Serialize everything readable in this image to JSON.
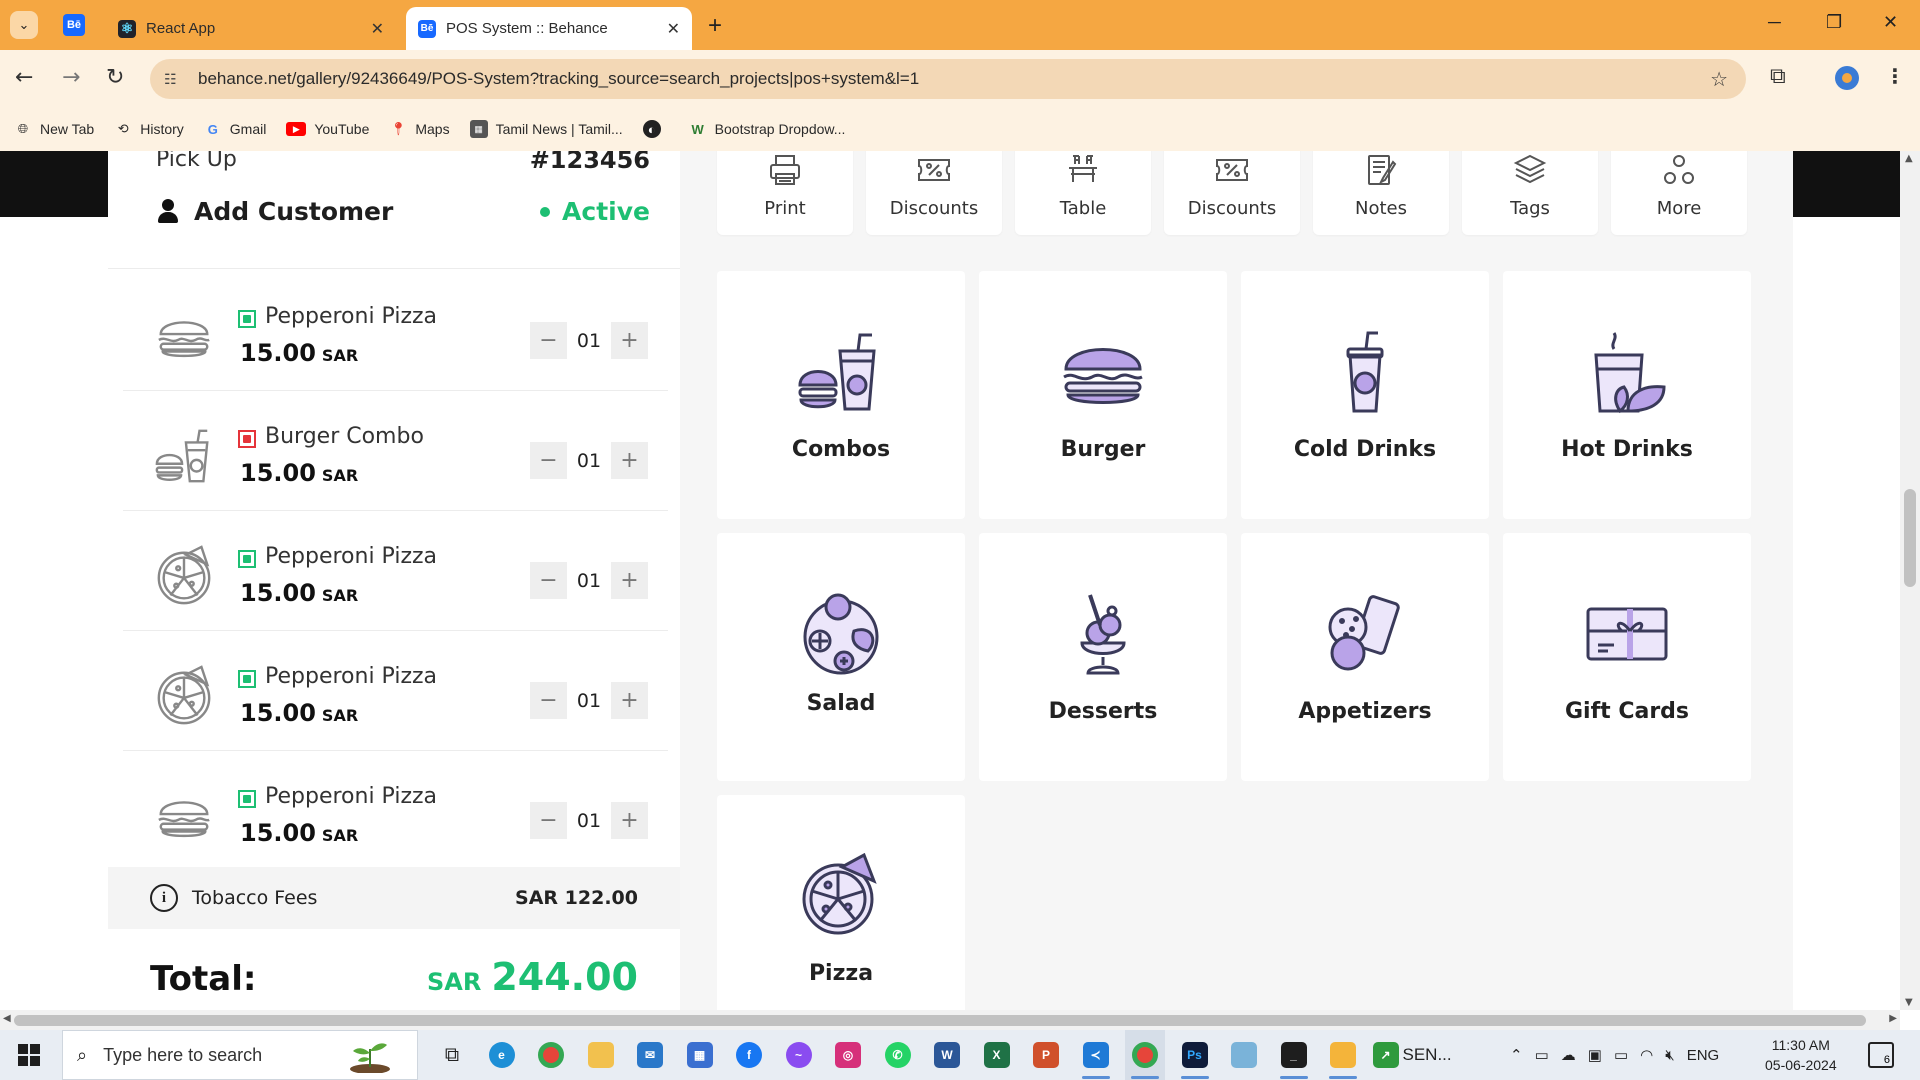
{
  "browser": {
    "tabs": [
      {
        "title": "React App",
        "favicon": "react-icon"
      },
      {
        "title": "POS System :: Behance",
        "favicon": "behance-icon"
      }
    ],
    "pinned_label": "Bē",
    "url": "behance.net/gallery/92436649/POS-System?tracking_source=search_projects|pos+system&l=1",
    "bookmarks": [
      {
        "label": "New Tab",
        "icon": "globe-icon"
      },
      {
        "label": "History",
        "icon": "history-icon"
      },
      {
        "label": "Gmail",
        "icon": "google-icon"
      },
      {
        "label": "YouTube",
        "icon": "youtube-icon"
      },
      {
        "label": "Maps",
        "icon": "maps-icon"
      },
      {
        "label": "Tamil News | Tamil...",
        "icon": "news-icon"
      },
      {
        "label": "",
        "icon": "globe-icon"
      },
      {
        "label": "Bootstrap Dropdow...",
        "icon": "w-icon"
      }
    ],
    "colors": {
      "tabbar": "#f5a742",
      "toolbar": "#fdf2e2"
    }
  },
  "order": {
    "type": "Pick Up",
    "number": "#123456",
    "add_customer": "Add Customer",
    "status": "Active",
    "items": [
      {
        "name": "Pepperoni Pizza",
        "price": "15.00",
        "currency": "SAR",
        "qty": "01",
        "veg": true,
        "icon": "burger-icon"
      },
      {
        "name": "Burger Combo",
        "price": "15.00",
        "currency": "SAR",
        "qty": "01",
        "veg": false,
        "icon": "combo-icon"
      },
      {
        "name": "Pepperoni Pizza",
        "price": "15.00",
        "currency": "SAR",
        "qty": "01",
        "veg": true,
        "icon": "pizza-icon"
      },
      {
        "name": "Pepperoni Pizza",
        "price": "15.00",
        "currency": "SAR",
        "qty": "01",
        "veg": true,
        "icon": "pizza-icon"
      },
      {
        "name": "Pepperoni Pizza",
        "price": "15.00",
        "currency": "SAR",
        "qty": "01",
        "veg": true,
        "icon": "burger-icon"
      }
    ],
    "fees_label": "Tobacco Fees",
    "fees_value": "SAR 122.00",
    "total_label": "Total:",
    "total_currency": "SAR",
    "total_amount": "244.00",
    "colors": {
      "accent": "#1dbf73",
      "nonveg": "#e5343a"
    }
  },
  "actions": [
    {
      "label": "Print",
      "icon": "printer-icon"
    },
    {
      "label": "Discounts",
      "icon": "discount-icon",
      "badge": true
    },
    {
      "label": "Table",
      "icon": "table-icon"
    },
    {
      "label": "Discounts",
      "icon": "discount-icon"
    },
    {
      "label": "Notes",
      "icon": "notes-icon"
    },
    {
      "label": "Tags",
      "icon": "tags-icon"
    },
    {
      "label": "More",
      "icon": "more-icon"
    }
  ],
  "categories": [
    {
      "label": "Combos",
      "icon": "combos-icon"
    },
    {
      "label": "Burger",
      "icon": "burger-icon"
    },
    {
      "label": "Cold Drinks",
      "icon": "cold-drink-icon"
    },
    {
      "label": "Hot Drinks",
      "icon": "hot-drink-icon"
    },
    {
      "label": "Salad",
      "icon": "salad-icon"
    },
    {
      "label": "Desserts",
      "icon": "dessert-icon"
    },
    {
      "label": "Appetizers",
      "icon": "appetizer-icon"
    },
    {
      "label": "Gift Cards",
      "icon": "gift-card-icon"
    },
    {
      "label": "Pizza",
      "icon": "pizza-icon"
    }
  ],
  "taskbar": {
    "search_placeholder": "Type here to search",
    "sen_label": "SEN...",
    "lang": "ENG",
    "time": "11:30 AM",
    "date": "05-06-2024",
    "notifications": "6"
  }
}
